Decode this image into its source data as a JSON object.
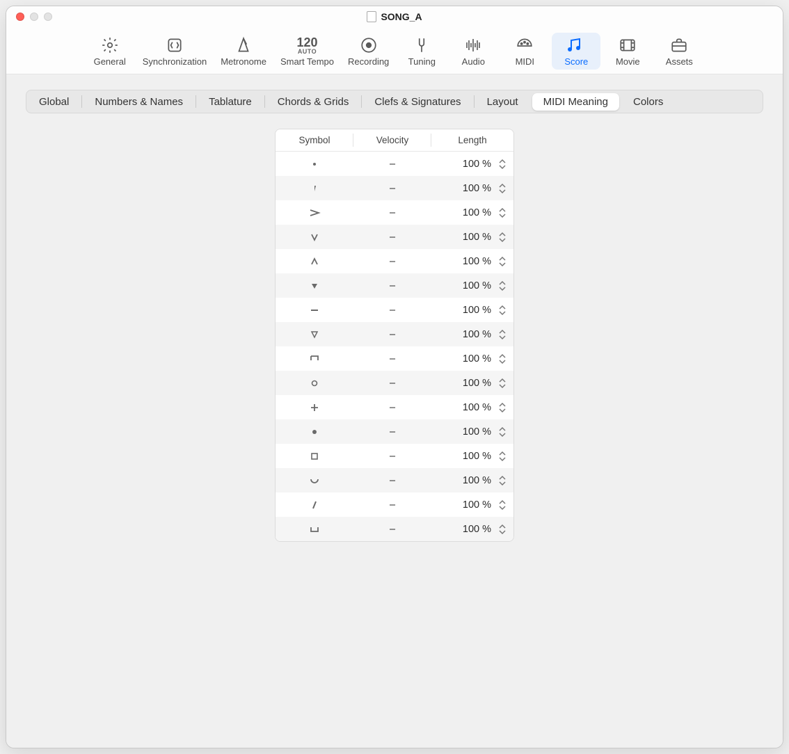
{
  "window": {
    "title": "SONG_A"
  },
  "toolbar": {
    "general": "General",
    "synchronization": "Synchronization",
    "metronome": "Metronome",
    "smart_tempo": "Smart Tempo",
    "smart_tempo_bpm": "120",
    "smart_tempo_mode": "AUTO",
    "recording": "Recording",
    "tuning": "Tuning",
    "audio": "Audio",
    "midi": "MIDI",
    "score": "Score",
    "movie": "Movie",
    "assets": "Assets",
    "active": "score"
  },
  "subtabs": {
    "global": "Global",
    "numbers_names": "Numbers & Names",
    "tablature": "Tablature",
    "chords_grids": "Chords & Grids",
    "clefs_signatures": "Clefs & Signatures",
    "layout": "Layout",
    "midi_meaning": "MIDI Meaning",
    "colors": "Colors",
    "active": "midi_meaning"
  },
  "table": {
    "col_symbol": "Symbol",
    "col_velocity": "Velocity",
    "col_length": "Length",
    "rows": [
      {
        "symbol": "staccato-dot",
        "velocity": "–",
        "length": "100 %"
      },
      {
        "symbol": "staccatissimo-down",
        "velocity": "–",
        "length": "100 %"
      },
      {
        "symbol": "accent",
        "velocity": "–",
        "length": "100 %"
      },
      {
        "symbol": "marcato-down",
        "velocity": "–",
        "length": "100 %"
      },
      {
        "symbol": "marcato-up",
        "velocity": "–",
        "length": "100 %"
      },
      {
        "symbol": "triangle-down-fill",
        "velocity": "–",
        "length": "100 %"
      },
      {
        "symbol": "tenuto",
        "velocity": "–",
        "length": "100 %"
      },
      {
        "symbol": "open-triangle-down",
        "velocity": "–",
        "length": "100 %"
      },
      {
        "symbol": "downbow",
        "velocity": "–",
        "length": "100 %"
      },
      {
        "symbol": "harmonic-circle",
        "velocity": "–",
        "length": "100 %"
      },
      {
        "symbol": "plus",
        "velocity": "–",
        "length": "100 %"
      },
      {
        "symbol": "filled-dot",
        "velocity": "–",
        "length": "100 %"
      },
      {
        "symbol": "square",
        "velocity": "–",
        "length": "100 %"
      },
      {
        "symbol": "fermata-arc",
        "velocity": "–",
        "length": "100 %"
      },
      {
        "symbol": "slash",
        "velocity": "–",
        "length": "100 %"
      },
      {
        "symbol": "upbow-bracket",
        "velocity": "–",
        "length": "100 %"
      }
    ]
  }
}
